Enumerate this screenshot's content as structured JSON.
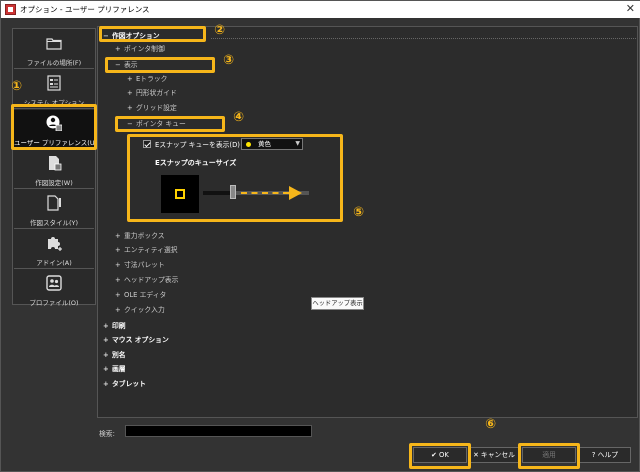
{
  "window": {
    "title": "オプション - ユーザー プリファレンス",
    "close_glyph": "✕"
  },
  "sidebar": {
    "items": [
      {
        "label": "ファイルの場所(F)",
        "icon": "folder-icon"
      },
      {
        "label": "システム オプション",
        "icon": "system-options-icon"
      },
      {
        "label": "ユーザー プリファレンス(U)",
        "icon": "user-preferences-icon",
        "selected": true
      },
      {
        "label": "作図設定(W)",
        "icon": "drafting-settings-icon"
      },
      {
        "label": "作図スタイル(Y)",
        "icon": "drafting-style-icon"
      },
      {
        "label": "アドイン(A)",
        "icon": "puzzle-icon"
      },
      {
        "label": "プロファイル(O)",
        "icon": "profile-icon"
      }
    ]
  },
  "tree": {
    "drawing_options": "作図オプション",
    "pointer_control": "ポインタ制御",
    "display": "表示",
    "etrack": "Eトラック",
    "circle_guide": "円形状ガイド",
    "grid_settings": "グリッド設定",
    "pointer_cue": "ポインタ キュー",
    "gravity_box": "重力ボックス",
    "entity_select": "エンティティ選択",
    "dimension_palette": "寸法パレット",
    "headsup_display": "ヘッドアップ表示",
    "ole_editor": "OLE エディタ",
    "quick_input": "クイック入力",
    "print": "印刷",
    "mouse_options": "マウス オプション",
    "alias": "別名",
    "screen": "画層",
    "tablet": "タブレット",
    "plus": "+",
    "minus": "−"
  },
  "pointer_cue": {
    "show_label": "Eスナップ キューを表示(D)",
    "show_checked": true,
    "color_value": "黄色",
    "color_hex": "#ffe600",
    "size_label": "Eスナップのキューサイズ",
    "size_level": 0.28
  },
  "tooltip": "ヘッドアップ表示",
  "callouts": [
    "①",
    "②",
    "③",
    "④",
    "⑤",
    "⑥"
  ],
  "search": {
    "label": "検索:",
    "value": ""
  },
  "buttons": {
    "ok": "✔ OK",
    "cancel": "✕ キャンセル",
    "apply": "適用",
    "help": "? ヘルプ"
  },
  "colors": {
    "highlight": "#f6b61a",
    "background": "#333333",
    "panel": "#2c2c2c"
  }
}
